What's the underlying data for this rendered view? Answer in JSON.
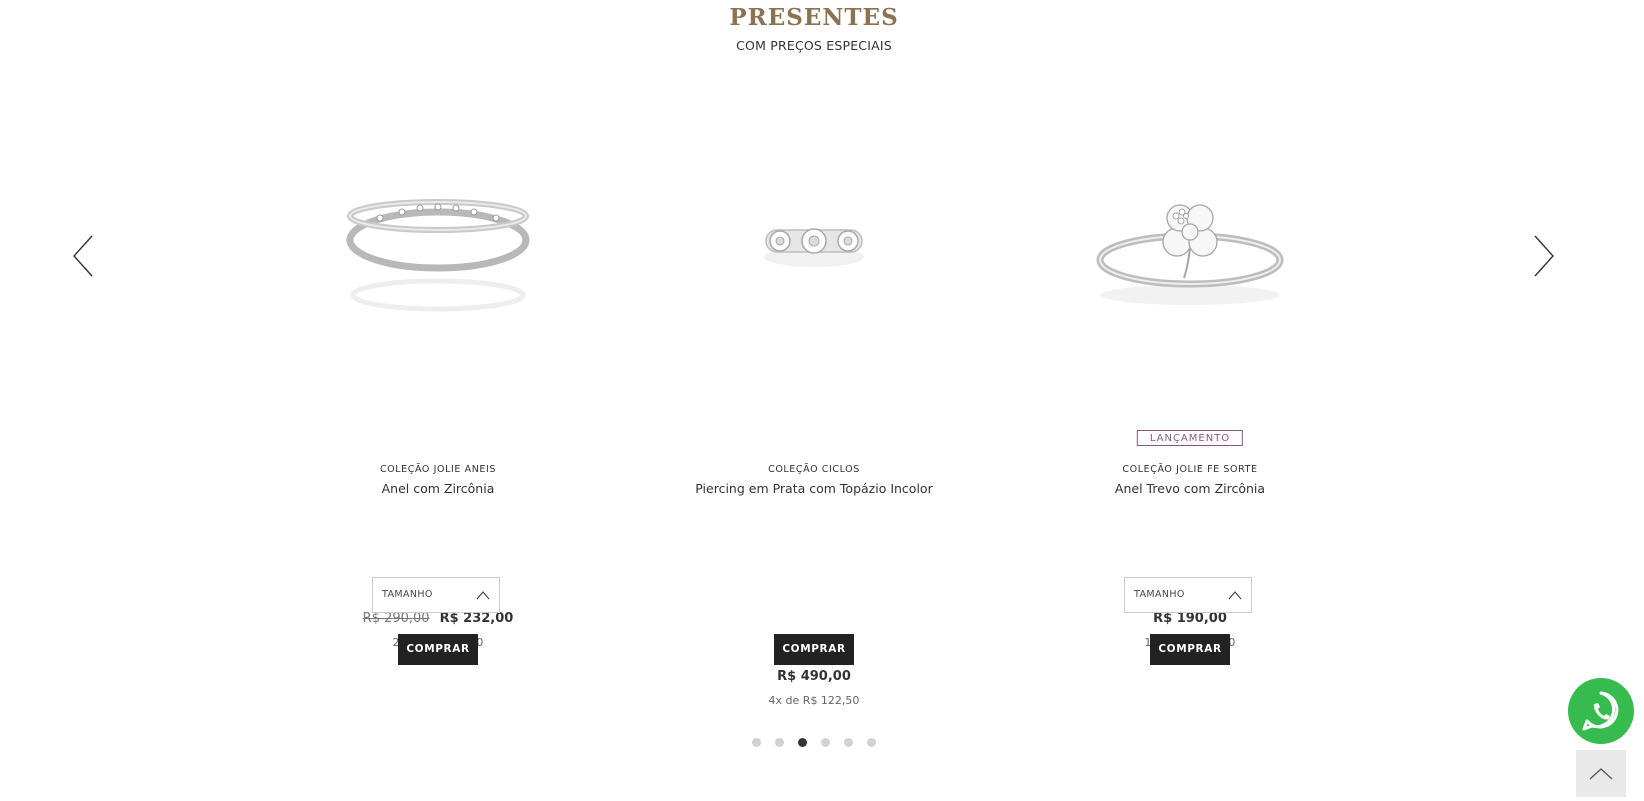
{
  "section": {
    "title": "PRESENTES",
    "subtitle": "COM PREÇOS ESPECIAIS"
  },
  "carousel": {
    "prev_icon": "chevron-left-icon",
    "next_icon": "chevron-right-icon",
    "dots_count": 6,
    "active_dot": 3
  },
  "products": [
    {
      "image": "eternity-ring-image",
      "badge": "",
      "collection": "COLEÇÃO JOLIE ANEIS",
      "name": "Anel com Zircônia",
      "old_price": "R$ 290,00",
      "price": "R$ 232,00",
      "installments": "2x de R$ 116,00",
      "size_label": "TAMANHO",
      "buy_label": "COMPRAR"
    },
    {
      "image": "piercing-image",
      "badge": "",
      "collection": "COLEÇÃO CICLOS",
      "name": "Piercing em Prata com Topázio Incolor",
      "old_price": "",
      "price": "R$ 490,00",
      "installments": "4x de R$ 122,50",
      "size_label": "",
      "buy_label": "COMPRAR"
    },
    {
      "image": "clover-ring-image",
      "badge": "LANÇAMENTO",
      "collection": "COLEÇÃO JOLIE FE SORTE",
      "name": "Anel Trevo com Zircônia",
      "old_price": "",
      "price": "R$ 190,00",
      "installments": "1x de R$ 190,00",
      "size_label": "TAMANHO",
      "buy_label": "COMPRAR"
    }
  ],
  "floating": {
    "whatsapp_icon": "whatsapp-icon",
    "back_to_top_icon": "chevron-up-icon"
  },
  "colors": {
    "title": "#8b7250",
    "badge": "#8a5a7a",
    "buy_button": "#222222",
    "whatsapp": "#36bb4e"
  }
}
